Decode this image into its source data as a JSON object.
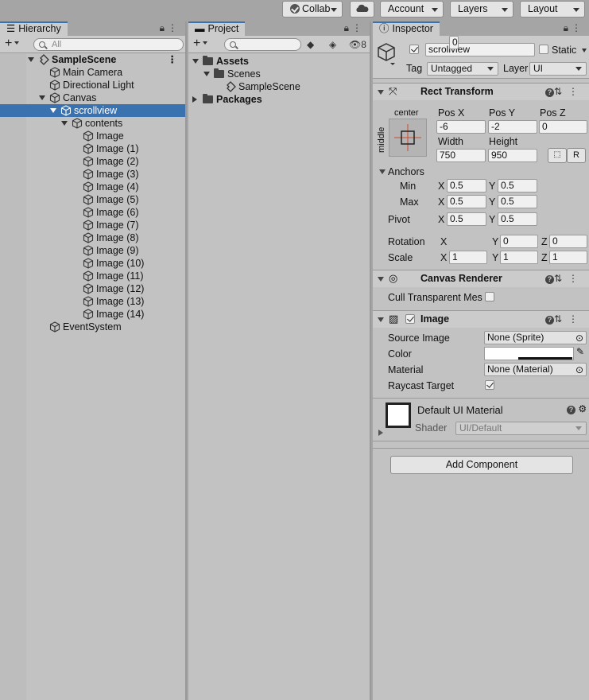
{
  "toolbar": {
    "collab": "Collab",
    "account": "Account",
    "layers": "Layers",
    "layout": "Layout"
  },
  "hierarchy": {
    "tab": "Hierarchy",
    "search_placeholder": "All",
    "items": [
      {
        "label": "SampleScene",
        "depth": 0,
        "type": "scene",
        "expanded": true
      },
      {
        "label": "Main Camera",
        "depth": 1,
        "type": "object"
      },
      {
        "label": "Directional Light",
        "depth": 1,
        "type": "object"
      },
      {
        "label": "Canvas",
        "depth": 1,
        "type": "object",
        "expanded": true
      },
      {
        "label": "scrollview",
        "depth": 2,
        "type": "object",
        "expanded": true,
        "selected": true
      },
      {
        "label": "contents",
        "depth": 3,
        "type": "object",
        "expanded": true
      },
      {
        "label": "Image",
        "depth": 4,
        "type": "object"
      },
      {
        "label": "Image (1)",
        "depth": 4,
        "type": "object"
      },
      {
        "label": "Image (2)",
        "depth": 4,
        "type": "object"
      },
      {
        "label": "Image (3)",
        "depth": 4,
        "type": "object"
      },
      {
        "label": "Image (4)",
        "depth": 4,
        "type": "object"
      },
      {
        "label": "Image (5)",
        "depth": 4,
        "type": "object"
      },
      {
        "label": "Image (6)",
        "depth": 4,
        "type": "object"
      },
      {
        "label": "Image (7)",
        "depth": 4,
        "type": "object"
      },
      {
        "label": "Image (8)",
        "depth": 4,
        "type": "object"
      },
      {
        "label": "Image (9)",
        "depth": 4,
        "type": "object"
      },
      {
        "label": "Image (10)",
        "depth": 4,
        "type": "object"
      },
      {
        "label": "Image (11)",
        "depth": 4,
        "type": "object"
      },
      {
        "label": "Image (12)",
        "depth": 4,
        "type": "object"
      },
      {
        "label": "Image (13)",
        "depth": 4,
        "type": "object"
      },
      {
        "label": "Image (14)",
        "depth": 4,
        "type": "object"
      },
      {
        "label": "EventSystem",
        "depth": 1,
        "type": "object"
      }
    ]
  },
  "project": {
    "tab": "Project",
    "hidden_count": "8",
    "items": [
      {
        "label": "Assets",
        "depth": 0,
        "type": "folder",
        "expanded": true,
        "bold": true
      },
      {
        "label": "Scenes",
        "depth": 1,
        "type": "folder",
        "expanded": true
      },
      {
        "label": "SampleScene",
        "depth": 2,
        "type": "scene"
      },
      {
        "label": "Packages",
        "depth": 0,
        "type": "folder",
        "expanded": false,
        "bold": true
      }
    ]
  },
  "inspector": {
    "tab": "Inspector",
    "object_name": "scrollview",
    "active": true,
    "static_label": "Static",
    "tag_label": "Tag",
    "tag_value": "Untagged",
    "layer_label": "Layer",
    "layer_value": "UI",
    "rect_transform": {
      "title": "Rect Transform",
      "anchor_h": "center",
      "anchor_v": "middle",
      "pos_x_label": "Pos X",
      "pos_x": "-6",
      "pos_y_label": "Pos Y",
      "pos_y": "-2",
      "pos_z_label": "Pos Z",
      "pos_z": "0",
      "width_label": "Width",
      "width": "750",
      "height_label": "Height",
      "height": "950",
      "r_button": "R",
      "anchors_label": "Anchors",
      "min_label": "Min",
      "min_x": "0.5",
      "min_y": "0.5",
      "max_label": "Max",
      "max_x": "0.5",
      "max_y": "0.5",
      "pivot_label": "Pivot",
      "pivot_x": "0.5",
      "pivot_y": "0.5",
      "rotation_label": "Rotation",
      "rot_x": "0",
      "rot_y": "0",
      "rot_z": "0",
      "scale_label": "Scale",
      "scale_x": "1",
      "scale_y": "1",
      "scale_z": "1",
      "x": "X",
      "y": "Y",
      "z": "Z"
    },
    "canvas_renderer": {
      "title": "Canvas Renderer",
      "cull_label": "Cull Transparent Mes",
      "cull_value": false
    },
    "image": {
      "title": "Image",
      "enabled": true,
      "source_label": "Source Image",
      "source_value": "None (Sprite)",
      "color_label": "Color",
      "color_value": "#ffffff",
      "material_label": "Material",
      "material_value": "None (Material)",
      "raycast_label": "Raycast Target",
      "raycast_value": true
    },
    "material_block": {
      "name": "Default UI Material",
      "shader_label": "Shader",
      "shader_value": "UI/Default"
    },
    "add_component": "Add Component"
  },
  "colors": {
    "selection": "#3a72b0",
    "panel_bg": "#c2c2c2",
    "toolbar_bg": "#a5a5a5"
  }
}
